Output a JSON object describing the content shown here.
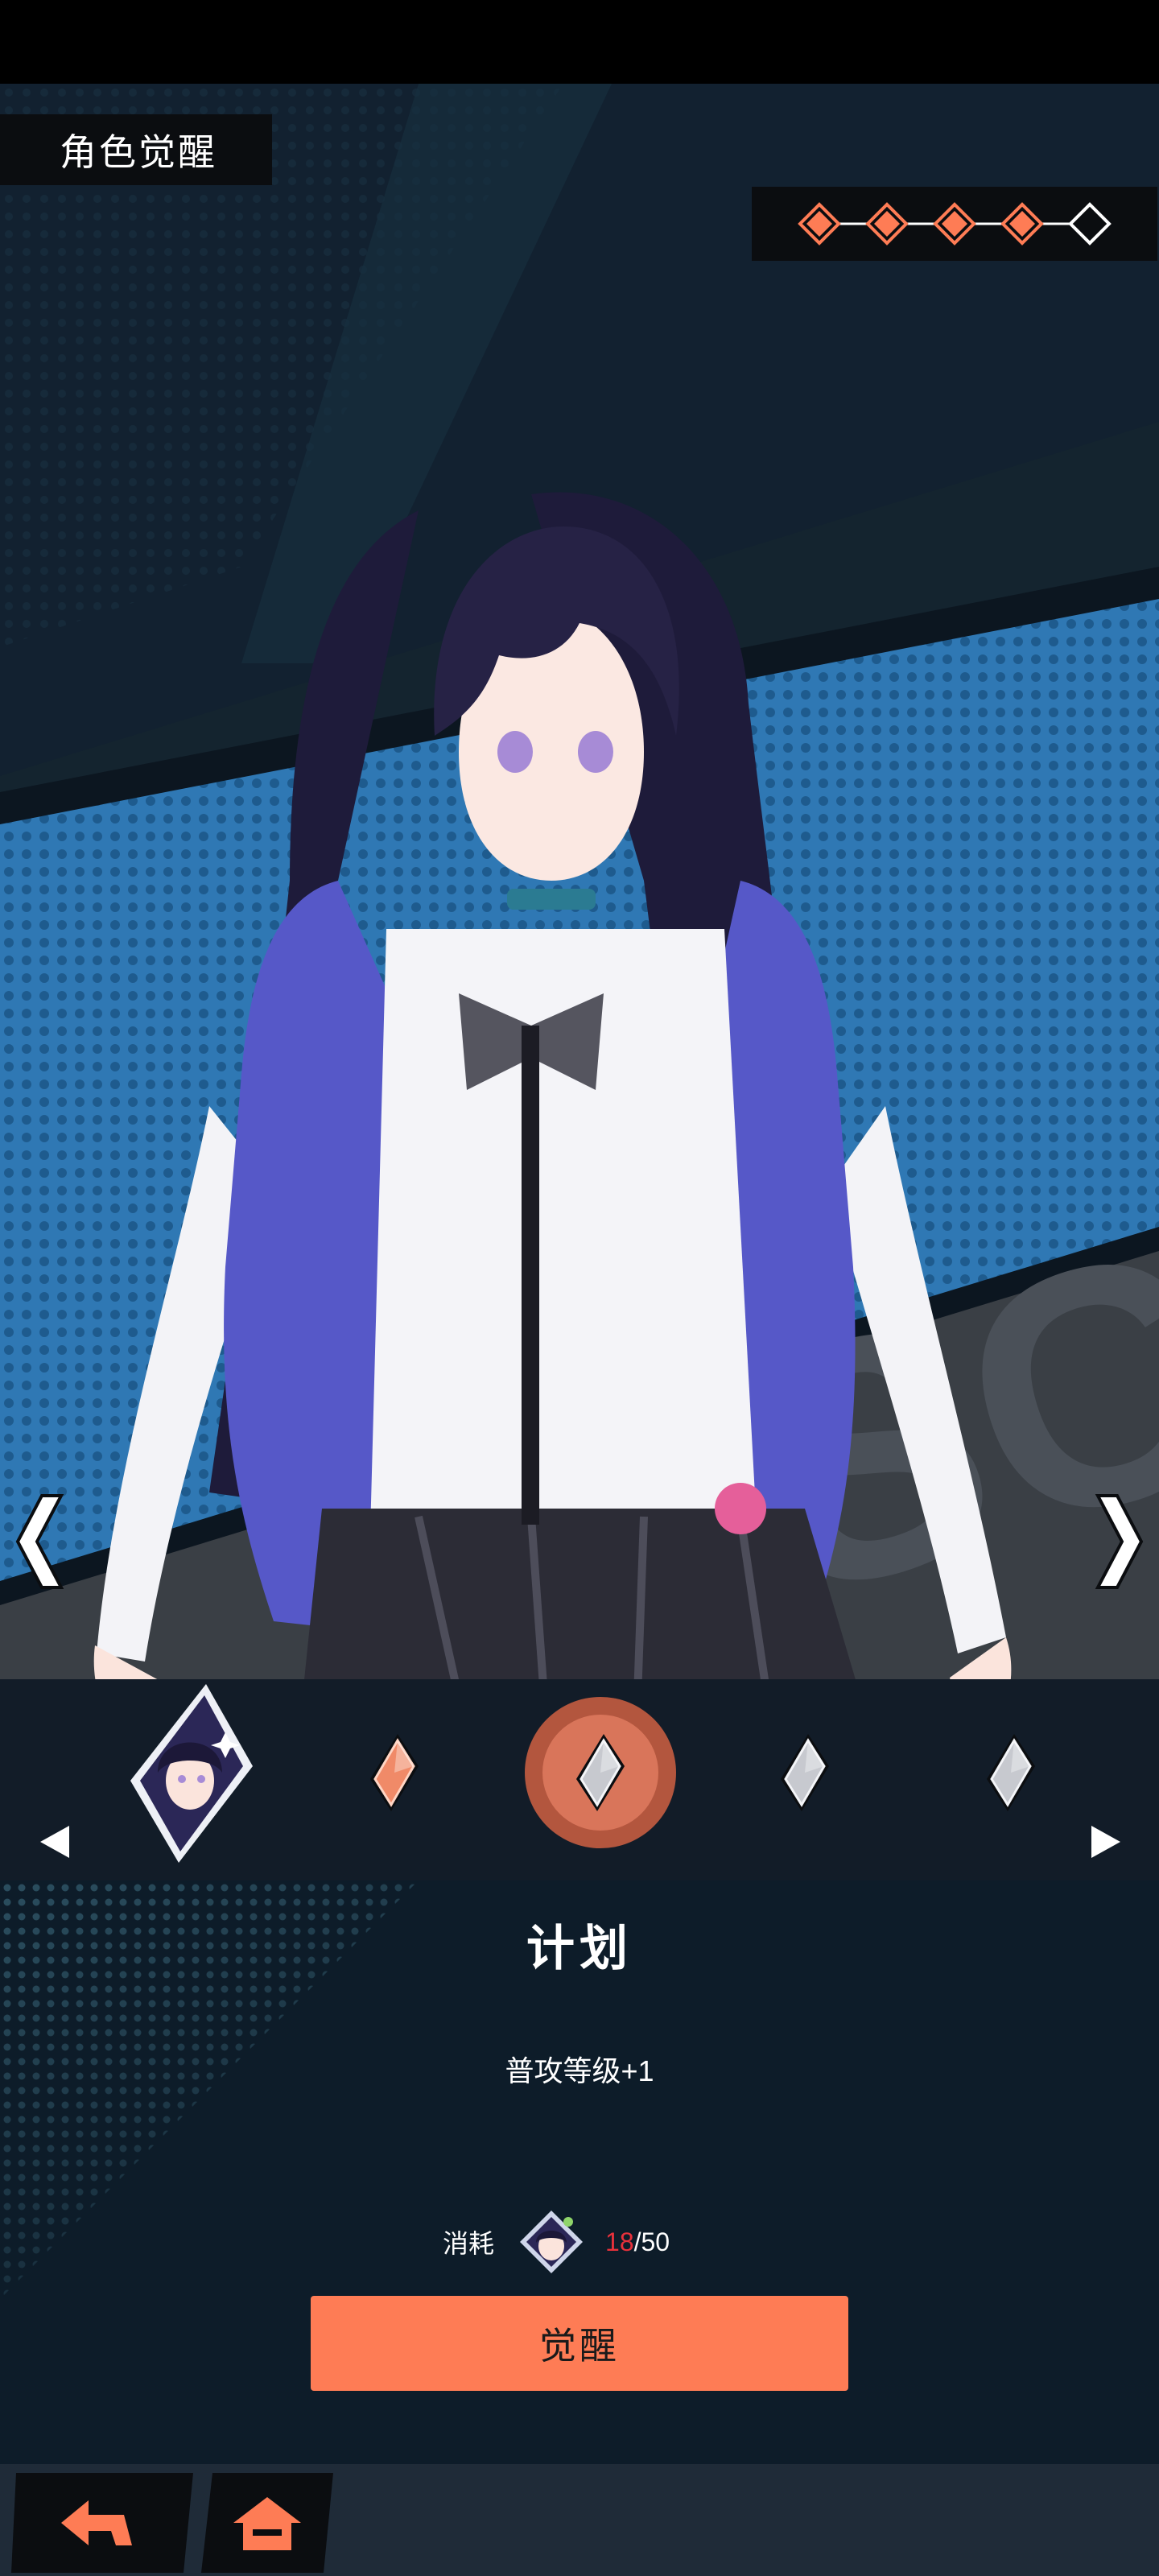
{
  "header": {
    "title": "角色觉醒"
  },
  "awaken_stars": {
    "filled": 4,
    "total": 5,
    "filled_color": "#fe7c55",
    "empty_color": "#ffffff"
  },
  "icons": {
    "prev_character": "chevron-left-icon",
    "next_character": "chevron-right-icon",
    "carousel_prev": "triangle-left-icon",
    "carousel_next": "triangle-right-icon",
    "back": "back-arrow-icon",
    "home": "home-icon"
  },
  "awaken_nodes": [
    {
      "type": "portrait"
    },
    {
      "type": "gem",
      "state": "unlocked"
    },
    {
      "type": "gem",
      "state": "selected"
    },
    {
      "type": "gem",
      "state": "locked"
    },
    {
      "type": "gem",
      "state": "locked"
    }
  ],
  "node": {
    "title": "计划",
    "description": "普攻等级+1"
  },
  "cost": {
    "label": "消耗",
    "have": "18",
    "separator": "/",
    "need": "50",
    "item_icon": "character-shard-icon"
  },
  "actions": {
    "awaken_label": "觉醒"
  },
  "colors": {
    "accent": "#fe7c55",
    "bg_blue": "#2f78b4",
    "panel": "#0d1c29",
    "shortage": "#e8313b"
  }
}
